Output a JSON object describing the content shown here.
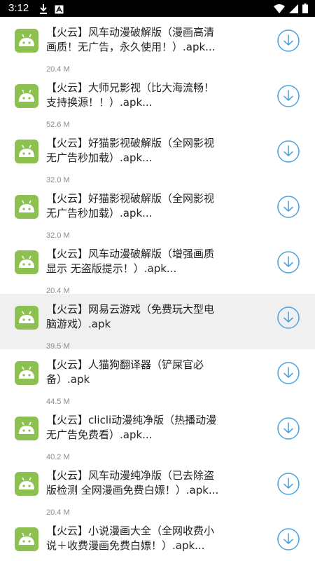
{
  "status_bar": {
    "time": "3:12",
    "left_icons": [
      "download-icon",
      "a-badge-icon"
    ],
    "right_icons": [
      "wifi-icon",
      "signal-icon",
      "battery-icon"
    ]
  },
  "colors": {
    "app_icon": "#8cc152",
    "download_icon": "#4aa3df",
    "highlight_row": "#f0f0f0"
  },
  "items": [
    {
      "title": "【火云】风车动漫破解版（漫画高清画质！无广告，永久使用！）.apk...",
      "size": "20.4 M"
    },
    {
      "title": "【火云】大师兄影视（比大海流畅！支持换源！！）.apk...",
      "size": "52.6 M"
    },
    {
      "title": "【火云】好猫影视破解版（全网影视 无广告秒加载）.apk...",
      "size": "32.0 M"
    },
    {
      "title": "【火云】好猫影视破解版（全网影视 无广告秒加载）.apk...",
      "size": "32.0 M"
    },
    {
      "title": "【火云】风车动漫破解版（增强画质显示 无盗版提示！）.apk...",
      "size": "20.4 M"
    },
    {
      "title": "【火云】网易云游戏（免费玩大型电脑游戏）.apk",
      "size": "39.5 M",
      "highlighted": true
    },
    {
      "title": "【火云】人猫狗翻译器（铲屎官必备）.apk",
      "size": "44.5 M"
    },
    {
      "title": "【火云】clicli动漫纯净版（热播动漫无广告免费看）.apk...",
      "size": "40.2 M"
    },
    {
      "title": "【火云】风车动漫纯净版（已去除盗版检测 全网漫画免费白嫖！）.apk...",
      "size": "20.4 M"
    },
    {
      "title": "【火云】小说漫画大全（全网收费小说＋收费漫画免费白嫖！）.apk...",
      "size": ""
    }
  ]
}
